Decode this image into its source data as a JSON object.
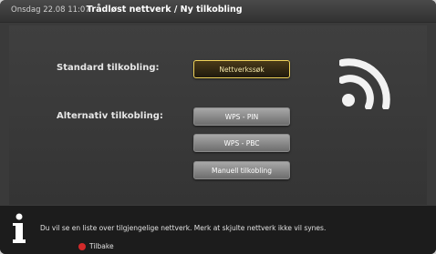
{
  "header": {
    "datetime": "Onsdag 22.08 11:07",
    "breadcrumb": "Trådløst nettverk / Ny tilkobling"
  },
  "main": {
    "standard_label": "Standard tilkobling:",
    "alternative_label": "Alternativ tilkobling:",
    "buttons": {
      "network_search": "Nettverkssøk",
      "wps_pin": "WPS - PIN",
      "wps_pbc": "WPS - PBC",
      "manual": "Manuell tilkobling"
    },
    "side_icon": "wifi-signal-icon"
  },
  "footer": {
    "info_icon": "info-icon",
    "message": "Du vil se en liste over tilgjengelige nettverk. Merk at skjulte nettverk ikke vil synes.",
    "back_label": "Tilbake"
  },
  "colors": {
    "focus_border": "#f0d35a",
    "back_key": "#d22a2a"
  }
}
